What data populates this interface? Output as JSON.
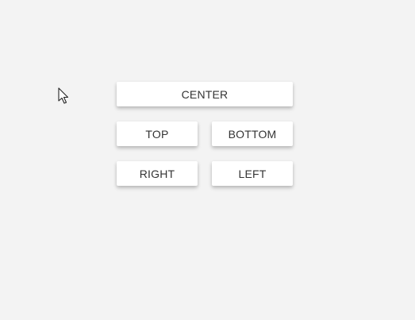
{
  "buttons": {
    "center_label": "CENTER",
    "top_label": "TOP",
    "bottom_label": "BOTTOM",
    "right_label": "RIGHT",
    "left_label": "LEFT"
  },
  "cursor": {
    "icon": "arrow-pointer-icon"
  },
  "colors": {
    "background": "#f3f3f3",
    "button_bg": "#ffffff",
    "button_text": "#333333"
  }
}
